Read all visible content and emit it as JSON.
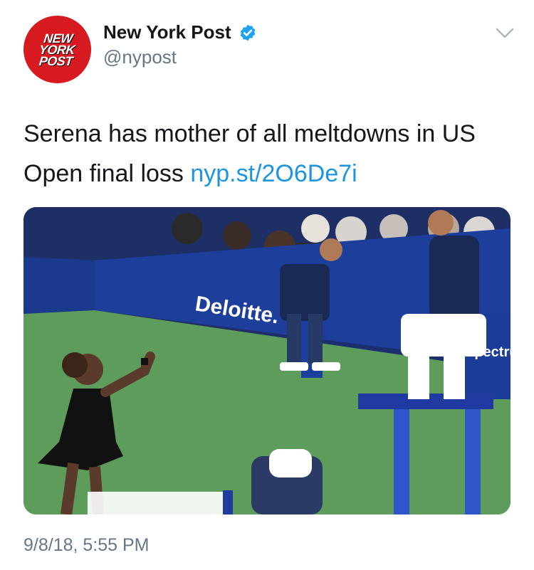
{
  "author": {
    "display_name": "New York Post",
    "handle": "@nypost",
    "verified": true,
    "avatar_logo_lines": [
      "NEW",
      "YORK",
      "POST"
    ],
    "avatar_color": "#d71920"
  },
  "tweet": {
    "text": "Serena has mother of all meltdowns in US Open final loss ",
    "link": "nyp.st/2O6De7i",
    "link_color": "#1b95e0",
    "timestamp": "9/8/18, 5:55 PM"
  },
  "photo": {
    "signage": [
      "Deloitte.",
      "Spectru"
    ]
  },
  "icons": {
    "verified": "verified-badge-icon",
    "menu": "chevron-down-icon"
  }
}
